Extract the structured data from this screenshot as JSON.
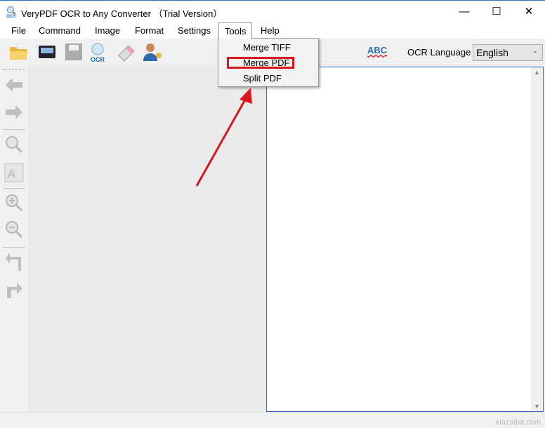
{
  "window": {
    "title": "VeryPDF OCR to Any Converter （Trial Version）",
    "minimize": "—",
    "maximize": "☐",
    "close": "✕"
  },
  "menu": [
    "File",
    "Command",
    "Image",
    "Format",
    "Settings",
    "Tools",
    "Help"
  ],
  "tools_menu": {
    "items": [
      "Merge TIFF",
      "Merge PDF",
      "Split PDF"
    ],
    "highlighted": "Merge PDF"
  },
  "toolbar": {
    "icons": [
      "open-folder-icon",
      "scanner-icon",
      "save-icon",
      "ocr-icon",
      "eraser-icon",
      "user-key-icon"
    ],
    "spellcheck_icon": "ABC",
    "ocr_language_label": "OCR Language",
    "ocr_language_value": "English"
  },
  "left_toolbar": [
    "back-icon",
    "forward-icon",
    "zoom-fit-icon",
    "text-size-icon",
    "zoom-in-icon",
    "zoom-out-icon",
    "rotate-left-icon",
    "rotate-right-icon"
  ],
  "watermark": "xiazaiba.com",
  "colors": {
    "annotation": "#d9151d",
    "accent": "#2b6fb5"
  }
}
